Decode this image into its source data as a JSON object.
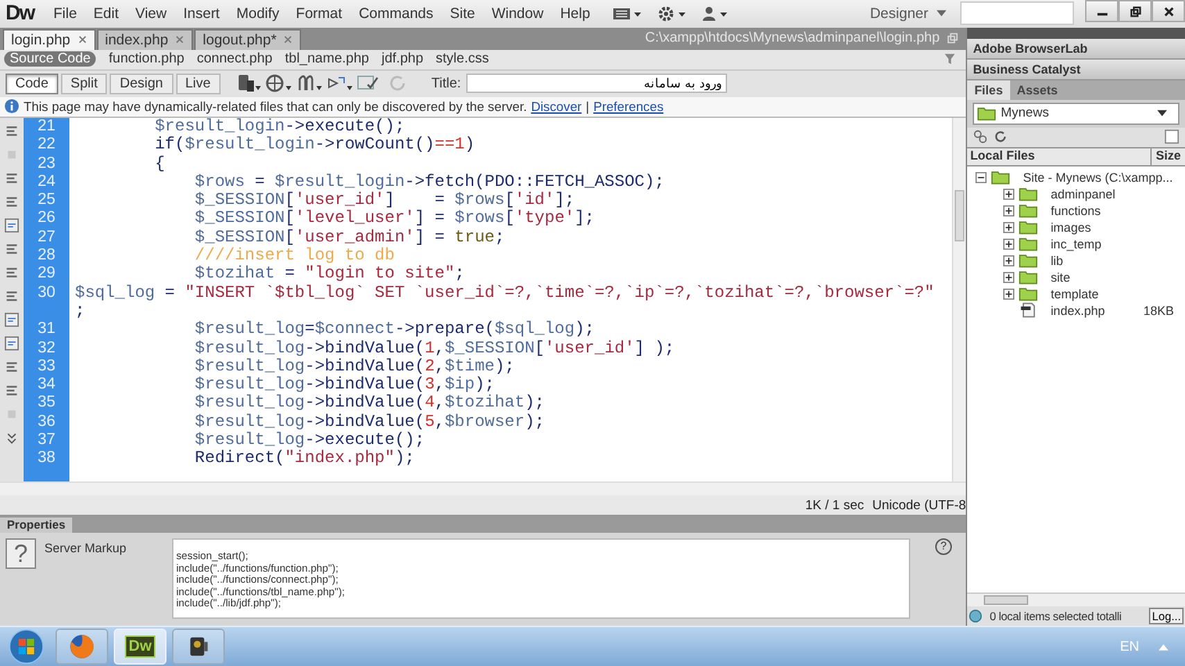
{
  "menu_bar": {
    "logo": "Dw",
    "items": [
      "File",
      "Edit",
      "View",
      "Insert",
      "Modify",
      "Format",
      "Commands",
      "Site",
      "Window",
      "Help"
    ],
    "workspace": "Designer"
  },
  "document_tabs": [
    {
      "label": "login.php",
      "selected": true
    },
    {
      "label": "index.php",
      "selected": false
    },
    {
      "label": "logout.php*",
      "selected": false
    }
  ],
  "file_path": "C:\\xampp\\htdocs\\Mynews\\adminpanel\\login.php",
  "related_files": [
    {
      "label": "Source Code",
      "selected": true
    },
    {
      "label": "function.php",
      "selected": false
    },
    {
      "label": "connect.php",
      "selected": false
    },
    {
      "label": "tbl_name.php",
      "selected": false
    },
    {
      "label": "jdf.php",
      "selected": false
    },
    {
      "label": "style.css",
      "selected": false
    }
  ],
  "view_buttons": [
    {
      "label": "Code",
      "selected": true
    },
    {
      "label": "Split",
      "selected": false
    },
    {
      "label": "Design",
      "selected": false
    },
    {
      "label": "Live",
      "selected": false
    }
  ],
  "title_field": {
    "label": "Title:",
    "value": "ورود به سامانه"
  },
  "info_bar": {
    "message": "This page may have dynamically-related files that can only be discovered by the server.",
    "links": [
      "Discover",
      "Preferences"
    ],
    "separator": "|"
  },
  "code_lines": [
    {
      "number": "21",
      "tokens": [
        {
          "kind": "var",
          "text": "        $result_login"
        },
        {
          "kind": "plain",
          "text": "->execute();"
        }
      ]
    },
    {
      "number": "22",
      "tokens": [
        {
          "kind": "plain",
          "text": "        if("
        },
        {
          "kind": "var",
          "text": "$result_login"
        },
        {
          "kind": "plain",
          "text": "->rowCount()"
        },
        {
          "kind": "num",
          "text": "==1"
        },
        {
          "kind": "plain",
          "text": ")"
        }
      ]
    },
    {
      "number": "23",
      "tokens": [
        {
          "kind": "plain",
          "text": "        {"
        }
      ]
    },
    {
      "number": "24",
      "tokens": [
        {
          "kind": "var",
          "text": "            $rows"
        },
        {
          "kind": "plain",
          "text": " = "
        },
        {
          "kind": "var",
          "text": "$result_login"
        },
        {
          "kind": "plain",
          "text": "->fetch(PDO::FETCH_ASSOC);"
        }
      ]
    },
    {
      "number": "25",
      "tokens": [
        {
          "kind": "var",
          "text": "            $_SESSION"
        },
        {
          "kind": "plain",
          "text": "["
        },
        {
          "kind": "str",
          "text": "'user_id'"
        },
        {
          "kind": "plain",
          "text": "]    = "
        },
        {
          "kind": "var",
          "text": "$rows"
        },
        {
          "kind": "plain",
          "text": "["
        },
        {
          "kind": "str",
          "text": "'id'"
        },
        {
          "kind": "plain",
          "text": "];"
        }
      ]
    },
    {
      "number": "26",
      "tokens": [
        {
          "kind": "var",
          "text": "            $_SESSION"
        },
        {
          "kind": "plain",
          "text": "["
        },
        {
          "kind": "str",
          "text": "'level_user'"
        },
        {
          "kind": "plain",
          "text": "] = "
        },
        {
          "kind": "var",
          "text": "$rows"
        },
        {
          "kind": "plain",
          "text": "["
        },
        {
          "kind": "str",
          "text": "'type'"
        },
        {
          "kind": "plain",
          "text": "];"
        }
      ]
    },
    {
      "number": "27",
      "tokens": [
        {
          "kind": "var",
          "text": "            $_SESSION"
        },
        {
          "kind": "plain",
          "text": "["
        },
        {
          "kind": "str",
          "text": "'user_admin'"
        },
        {
          "kind": "plain",
          "text": "] = "
        },
        {
          "kind": "kw",
          "text": "true"
        },
        {
          "kind": "plain",
          "text": ";"
        }
      ]
    },
    {
      "number": "28",
      "tokens": [
        {
          "kind": "comment",
          "text": "            ////insert log to db"
        }
      ]
    },
    {
      "number": "29",
      "tokens": [
        {
          "kind": "var",
          "text": "            $tozihat"
        },
        {
          "kind": "plain",
          "text": " = "
        },
        {
          "kind": "str",
          "text": "\"login to site\""
        },
        {
          "kind": "plain",
          "text": ";"
        }
      ]
    },
    {
      "number": "30",
      "tokens": [
        {
          "kind": "var",
          "text": "$sql_log"
        },
        {
          "kind": "plain",
          "text": " = "
        },
        {
          "kind": "str",
          "text": "\"INSERT `$tbl_log` SET `user_id`=?,`time`=?,`ip`=?,`tozihat`=?,`browser`=?\""
        }
      ],
      "wrap": [
        {
          "kind": "plain",
          "text": ";"
        }
      ]
    },
    {
      "number": "31",
      "tokens": [
        {
          "kind": "var",
          "text": "            $result_log"
        },
        {
          "kind": "plain",
          "text": "="
        },
        {
          "kind": "var",
          "text": "$connect"
        },
        {
          "kind": "plain",
          "text": "->prepare("
        },
        {
          "kind": "var",
          "text": "$sql_log"
        },
        {
          "kind": "plain",
          "text": ");"
        }
      ]
    },
    {
      "number": "32",
      "tokens": [
        {
          "kind": "var",
          "text": "            $result_log"
        },
        {
          "kind": "plain",
          "text": "->bindValue("
        },
        {
          "kind": "num",
          "text": "1"
        },
        {
          "kind": "plain",
          "text": ","
        },
        {
          "kind": "var",
          "text": "$_SESSION"
        },
        {
          "kind": "plain",
          "text": "["
        },
        {
          "kind": "str",
          "text": "'user_id'"
        },
        {
          "kind": "plain",
          "text": "] );"
        }
      ]
    },
    {
      "number": "33",
      "tokens": [
        {
          "kind": "var",
          "text": "            $result_log"
        },
        {
          "kind": "plain",
          "text": "->bindValue("
        },
        {
          "kind": "num",
          "text": "2"
        },
        {
          "kind": "plain",
          "text": ","
        },
        {
          "kind": "var",
          "text": "$time"
        },
        {
          "kind": "plain",
          "text": ");"
        }
      ]
    },
    {
      "number": "34",
      "tokens": [
        {
          "kind": "var",
          "text": "            $result_log"
        },
        {
          "kind": "plain",
          "text": "->bindValue("
        },
        {
          "kind": "num",
          "text": "3"
        },
        {
          "kind": "plain",
          "text": ","
        },
        {
          "kind": "var",
          "text": "$ip"
        },
        {
          "kind": "plain",
          "text": ");"
        }
      ]
    },
    {
      "number": "35",
      "tokens": [
        {
          "kind": "var",
          "text": "            $result_log"
        },
        {
          "kind": "plain",
          "text": "->bindValue("
        },
        {
          "kind": "num",
          "text": "4"
        },
        {
          "kind": "plain",
          "text": ","
        },
        {
          "kind": "var",
          "text": "$tozihat"
        },
        {
          "kind": "plain",
          "text": ");"
        }
      ]
    },
    {
      "number": "36",
      "tokens": [
        {
          "kind": "var",
          "text": "            $result_log"
        },
        {
          "kind": "plain",
          "text": "->bindValue("
        },
        {
          "kind": "num",
          "text": "5"
        },
        {
          "kind": "plain",
          "text": ","
        },
        {
          "kind": "var",
          "text": "$browser"
        },
        {
          "kind": "plain",
          "text": ");"
        }
      ]
    },
    {
      "number": "37",
      "tokens": [
        {
          "kind": "var",
          "text": "            $result_log"
        },
        {
          "kind": "plain",
          "text": "->execute();"
        }
      ]
    },
    {
      "number": "38",
      "tokens": [
        {
          "kind": "plain",
          "text": "            Redirect("
        },
        {
          "kind": "str",
          "text": "\"index.php\""
        },
        {
          "kind": "plain",
          "text": ");"
        }
      ]
    }
  ],
  "status_bar": {
    "transfer": "1K / 1 sec",
    "encoding": "Unicode (UTF-8"
  },
  "properties": {
    "title": "Properties",
    "icon": "?",
    "label": "Server Markup",
    "help": "?",
    "markup_lines": [
      "session_start();",
      "include(\"../functions/function.php\");",
      "include(\"../functions/connect.php\");",
      "include(\"../functions/tbl_name.php\");",
      "include(\"../lib/jdf.php\");"
    ]
  },
  "right_panel": {
    "panels": [
      "Adobe BrowserLab",
      "Business Catalyst"
    ],
    "tabs": [
      {
        "label": "Files",
        "selected": true
      },
      {
        "label": "Assets",
        "selected": false
      }
    ],
    "site": "Mynews",
    "columns": [
      "Local Files",
      "Size"
    ],
    "tree": [
      {
        "kind": "folder",
        "label": "Site - Mynews (C:\\xampp...",
        "expanded": true,
        "children": [
          {
            "kind": "folder",
            "label": "adminpanel",
            "expanded": false
          },
          {
            "kind": "folder",
            "label": "functions",
            "expanded": false
          },
          {
            "kind": "folder",
            "label": "images",
            "expanded": false
          },
          {
            "kind": "folder",
            "label": "inc_temp",
            "expanded": false
          },
          {
            "kind": "folder",
            "label": "lib",
            "expanded": false
          },
          {
            "kind": "folder",
            "label": "site",
            "expanded": false
          },
          {
            "kind": "folder",
            "label": "template",
            "expanded": false
          },
          {
            "kind": "file",
            "label": "index.php",
            "size": "18KB"
          }
        ]
      }
    ],
    "status": "0 local items selected totalli",
    "log_button": "Log..."
  },
  "taskbar": {
    "apps": [
      {
        "kind": "browser",
        "selected": false
      },
      {
        "kind": "dreamweaver",
        "label": "Dw",
        "selected": true
      },
      {
        "kind": "media",
        "selected": false
      }
    ],
    "language": "EN"
  }
}
